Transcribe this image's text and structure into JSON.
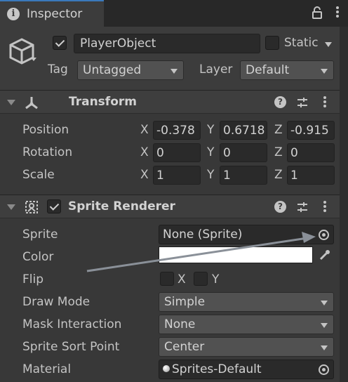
{
  "window": {
    "tab_title": "Inspector",
    "info_glyph": "i"
  },
  "header": {
    "object_name": "PlayerObject",
    "active_checked": true,
    "static_label": "Static",
    "static_checked": false,
    "tag_label": "Tag",
    "tag_value": "Untagged",
    "layer_label": "Layer",
    "layer_value": "Default"
  },
  "transform": {
    "title": "Transform",
    "help_glyph": "?",
    "rows": [
      {
        "label": "Position",
        "x": "-0.378",
        "y": "0.6718",
        "z": "-0.915"
      },
      {
        "label": "Rotation",
        "x": "0",
        "y": "0",
        "z": "0"
      },
      {
        "label": "Scale",
        "x": "1",
        "y": "1",
        "z": "1"
      }
    ],
    "axis_x": "X",
    "axis_y": "Y",
    "axis_z": "Z"
  },
  "sprite_renderer": {
    "title": "Sprite Renderer",
    "enabled": true,
    "help_glyph": "?",
    "sprite_label": "Sprite",
    "sprite_value": "None (Sprite)",
    "color_label": "Color",
    "color_value": "#ffffff",
    "flip_label": "Flip",
    "flip_x": "X",
    "flip_y": "Y",
    "draw_mode_label": "Draw Mode",
    "draw_mode_value": "Simple",
    "mask_label": "Mask Interaction",
    "mask_value": "None",
    "sort_point_label": "Sprite Sort Point",
    "sort_point_value": "Center",
    "material_label": "Material",
    "material_value": "Sprites-Default"
  },
  "colors": {
    "accent": "#3a79bb",
    "background": "#383838",
    "field": "#2a2a2a",
    "dropdown": "#515151"
  }
}
